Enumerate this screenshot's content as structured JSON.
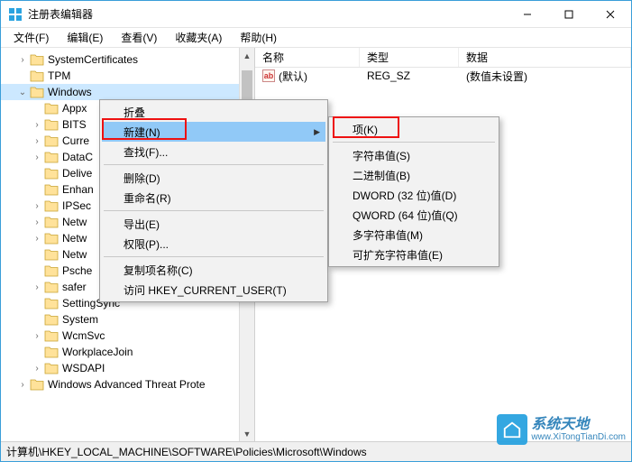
{
  "window": {
    "title": "注册表编辑器"
  },
  "menubar": {
    "file": "文件(F)",
    "edit": "编辑(E)",
    "view": "查看(V)",
    "favorites": "收藏夹(A)",
    "help": "帮助(H)"
  },
  "tree": {
    "items": [
      {
        "label": "SystemCertificates",
        "indent": 1,
        "expander": ">"
      },
      {
        "label": "TPM",
        "indent": 1,
        "expander": ""
      },
      {
        "label": "Windows",
        "indent": 1,
        "expander": "v",
        "selected": true
      },
      {
        "label": "Appx",
        "indent": 2,
        "expander": ""
      },
      {
        "label": "BITS",
        "indent": 2,
        "expander": ">"
      },
      {
        "label": "Curre",
        "indent": 2,
        "expander": ">"
      },
      {
        "label": "DataC",
        "indent": 2,
        "expander": ">"
      },
      {
        "label": "Delive",
        "indent": 2,
        "expander": ""
      },
      {
        "label": "Enhan",
        "indent": 2,
        "expander": ""
      },
      {
        "label": "IPSec",
        "indent": 2,
        "expander": ">"
      },
      {
        "label": "Netw",
        "indent": 2,
        "expander": ">"
      },
      {
        "label": "Netw",
        "indent": 2,
        "expander": ">"
      },
      {
        "label": "Netw",
        "indent": 2,
        "expander": ""
      },
      {
        "label": "Psche",
        "indent": 2,
        "expander": ""
      },
      {
        "label": "safer",
        "indent": 2,
        "expander": ">"
      },
      {
        "label": "SettingSync",
        "indent": 2,
        "expander": ""
      },
      {
        "label": "System",
        "indent": 2,
        "expander": ""
      },
      {
        "label": "WcmSvc",
        "indent": 2,
        "expander": ">"
      },
      {
        "label": "WorkplaceJoin",
        "indent": 2,
        "expander": ""
      },
      {
        "label": "WSDAPI",
        "indent": 2,
        "expander": ">"
      },
      {
        "label": "Windows Advanced Threat Prote",
        "indent": 1,
        "expander": ">"
      }
    ]
  },
  "list": {
    "headers": {
      "name": "名称",
      "type": "类型",
      "data": "数据"
    },
    "rows": [
      {
        "name": "(默认)",
        "type": "REG_SZ",
        "data": "(数值未设置)"
      }
    ]
  },
  "contextMenu1": {
    "collapse": "折叠",
    "new": "新建(N)",
    "find": "查找(F)...",
    "delete": "删除(D)",
    "rename": "重命名(R)",
    "export": "导出(E)",
    "permissions": "权限(P)...",
    "copyKeyName": "复制项名称(C)",
    "goToHKCU": "访问 HKEY_CURRENT_USER(T)"
  },
  "contextMenu2": {
    "key": "项(K)",
    "string": "字符串值(S)",
    "binary": "二进制值(B)",
    "dword": "DWORD (32 位)值(D)",
    "qword": "QWORD (64 位)值(Q)",
    "multiString": "多字符串值(M)",
    "expandString": "可扩充字符串值(E)"
  },
  "statusbar": {
    "path": "计算机\\HKEY_LOCAL_MACHINE\\SOFTWARE\\Policies\\Microsoft\\Windows"
  },
  "watermark": {
    "name": "系统天地",
    "url": "www.XiTongTianDi.com"
  }
}
